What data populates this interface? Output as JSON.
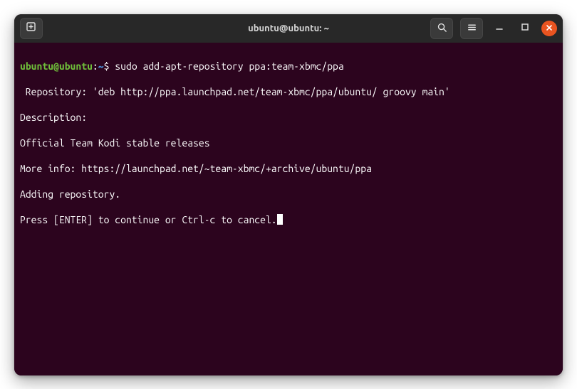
{
  "window": {
    "title": "ubuntu@ubuntu: ~"
  },
  "titlebar": {
    "new_tab_label": "New Tab",
    "search_label": "Search",
    "menu_label": "Menu",
    "minimize_label": "Minimize",
    "maximize_label": "Maximize",
    "close_label": "Close"
  },
  "prompt": {
    "user_host": "ubuntu@ubuntu",
    "path": "~",
    "symbol": "$"
  },
  "command": "sudo add-apt-repository ppa:team-xbmc/ppa",
  "output": [
    " Repository: 'deb http://ppa.launchpad.net/team-xbmc/ppa/ubuntu/ groovy main'",
    "Description:",
    "Official Team Kodi stable releases",
    "More info: https://launchpad.net/~team-xbmc/+archive/ubuntu/ppa",
    "Adding repository.",
    "Press [ENTER] to continue or Ctrl-c to cancel."
  ],
  "colors": {
    "window_bg": "#2c041e",
    "titlebar_bg": "#282828",
    "accent_close": "#e95420",
    "prompt_user": "#6fbf3a",
    "prompt_path": "#4a90d9",
    "text": "#ffffff"
  }
}
